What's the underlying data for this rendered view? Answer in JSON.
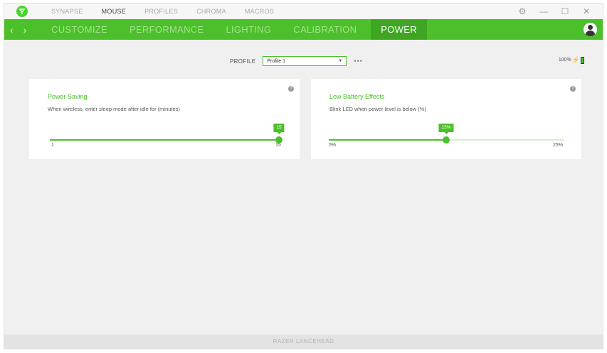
{
  "topnav": {
    "items": [
      {
        "label": "SYNAPSE",
        "active": false
      },
      {
        "label": "MOUSE",
        "active": true
      },
      {
        "label": "PROFILES",
        "active": false
      },
      {
        "label": "CHROMA",
        "active": false
      },
      {
        "label": "MACROS",
        "active": false
      }
    ]
  },
  "window_controls": {
    "settings": "⚙",
    "minimize": "—",
    "maximize": "☐",
    "close": "✕"
  },
  "subnav": {
    "back": "‹",
    "forward": "›",
    "tabs": [
      {
        "label": "CUSTOMIZE",
        "active": false
      },
      {
        "label": "PERFORMANCE",
        "active": false
      },
      {
        "label": "LIGHTING",
        "active": false
      },
      {
        "label": "CALIBRATION",
        "active": false
      },
      {
        "label": "POWER",
        "active": true
      }
    ]
  },
  "profile": {
    "label": "PROFILE",
    "value": "Profile 1",
    "more": "•••"
  },
  "battery": {
    "percent_text": "100%",
    "level": 1.0
  },
  "power_saving": {
    "title": "Power Saving",
    "description": "When wireless, enter sleep mode after idle for (minutes)",
    "value": "15",
    "min_label": "1",
    "max_label": "15",
    "fraction": 1.0
  },
  "low_battery": {
    "title": "Low Battery Effects",
    "description": "Blink LED when power level is below (%)",
    "value": "15%",
    "min_label": "5%",
    "max_label": "25%",
    "fraction": 0.5
  },
  "footer": {
    "device": "RAZER LANCEHEAD"
  },
  "colors": {
    "accent": "#4cc02a",
    "accent_dark": "#3fa624"
  }
}
